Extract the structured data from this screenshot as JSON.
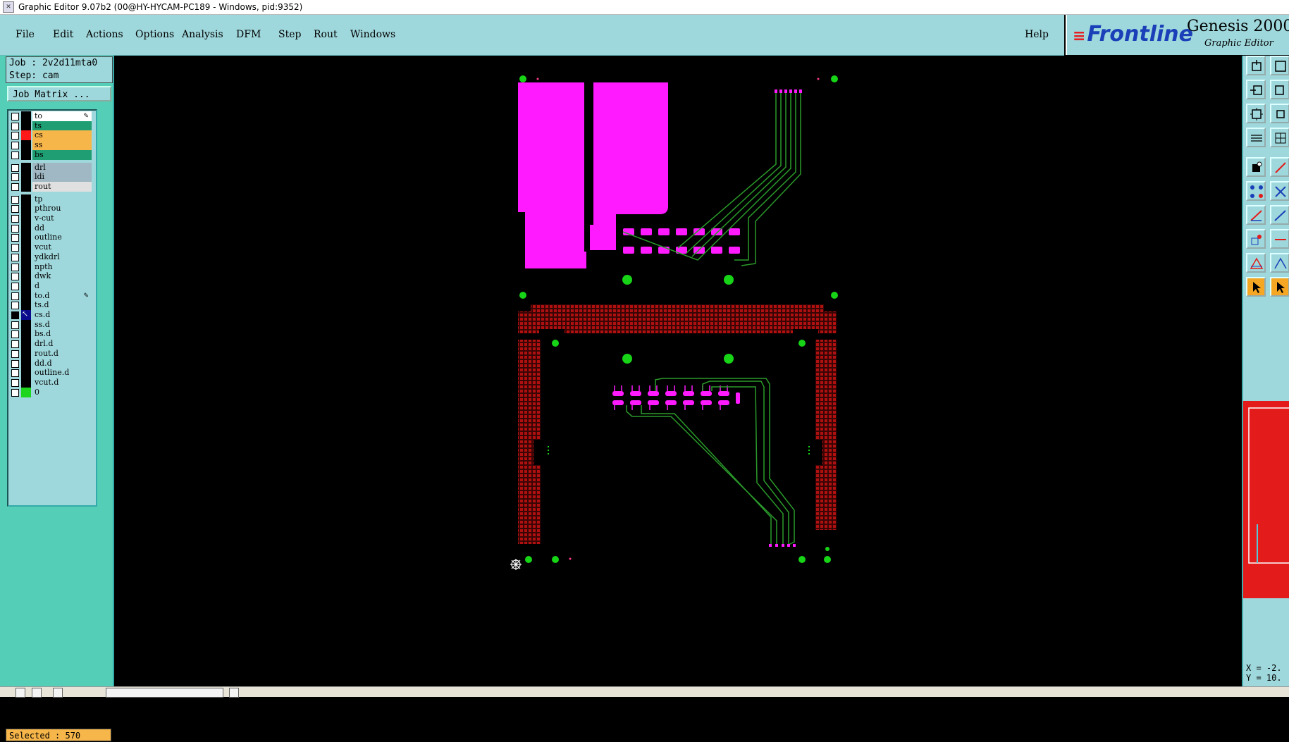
{
  "window": {
    "title": "Graphic Editor 9.07b2 (00@HY-HYCAM-PC189 - Windows, pid:9352)"
  },
  "menu": {
    "items": [
      "File",
      "Edit",
      "Actions",
      "Options",
      "Analysis",
      "DFM",
      "Step",
      "Rout",
      "Windows"
    ],
    "help": "Help"
  },
  "brand": {
    "logo": "Frontline",
    "product": "Genesis 2000",
    "subtitle": "Graphic Editor"
  },
  "job": {
    "job_line": "Job : 2v2d11mta0",
    "step_line": "Step: cam",
    "matrix_button": "Job Matrix ..."
  },
  "layers": [
    {
      "name": "to",
      "color": "#000000",
      "bg": "#ffffff",
      "mark": "edit"
    },
    {
      "name": "ts",
      "color": "#000000",
      "bg": "#1e9e72"
    },
    {
      "name": "cs",
      "color": "#ff1a1a",
      "bg": "#f6b64a"
    },
    {
      "name": "ss",
      "color": "#000000",
      "bg": "#f6b64a"
    },
    {
      "name": "bs",
      "color": "#000000",
      "bg": "#1e9e72"
    },
    {
      "name": "drl",
      "color": "#000000",
      "bg": "#9fb8c4"
    },
    {
      "name": "ldi",
      "color": "#000000",
      "bg": "#9fb8c4"
    },
    {
      "name": "rout",
      "color": "#000000",
      "bg": "#e0e0e0"
    },
    {
      "name": "tp",
      "color": "#000000",
      "bg": "#9fd8dc"
    },
    {
      "name": "pthrou",
      "color": "#000000",
      "bg": "#9fd8dc"
    },
    {
      "name": "v-cut",
      "color": "#000000",
      "bg": "#9fd8dc"
    },
    {
      "name": "dd",
      "color": "#000000",
      "bg": "#9fd8dc"
    },
    {
      "name": "outline",
      "color": "#000000",
      "bg": "#9fd8dc"
    },
    {
      "name": "vcut",
      "color": "#000000",
      "bg": "#9fd8dc"
    },
    {
      "name": "ydkdrl",
      "color": "#000000",
      "bg": "#9fd8dc"
    },
    {
      "name": "npth",
      "color": "#000000",
      "bg": "#9fd8dc"
    },
    {
      "name": "dwk",
      "color": "#000000",
      "bg": "#9fd8dc"
    },
    {
      "name": "d",
      "color": "#000000",
      "bg": "#9fd8dc"
    },
    {
      "name": "to.d",
      "color": "#000000",
      "bg": "#9fd8dc",
      "mark": "edit"
    },
    {
      "name": "ts.d",
      "color": "#000000",
      "bg": "#9fd8dc"
    },
    {
      "name": "cs.d",
      "color": "#0a0a8c",
      "bg": "#9fd8dc",
      "active": true
    },
    {
      "name": "ss.d",
      "color": "#000000",
      "bg": "#9fd8dc"
    },
    {
      "name": "bs.d",
      "color": "#000000",
      "bg": "#9fd8dc"
    },
    {
      "name": "drl.d",
      "color": "#000000",
      "bg": "#9fd8dc"
    },
    {
      "name": "rout.d",
      "color": "#000000",
      "bg": "#9fd8dc"
    },
    {
      "name": "dd.d",
      "color": "#000000",
      "bg": "#9fd8dc"
    },
    {
      "name": "outline.d",
      "color": "#000000",
      "bg": "#9fd8dc"
    },
    {
      "name": "vcut.d",
      "color": "#000000",
      "bg": "#9fd8dc"
    },
    {
      "name": "0",
      "color": "#1ed61e",
      "bg": "#9fd8dc"
    }
  ],
  "status": {
    "selected": "Selected : 570"
  },
  "coords": {
    "x": "X = -2.",
    "y": "Y = 10."
  },
  "colors": {
    "pad": "#ff1aff",
    "trace": "#2a9a2a",
    "fiducial": "#17d417",
    "hatch": "#b01010"
  }
}
